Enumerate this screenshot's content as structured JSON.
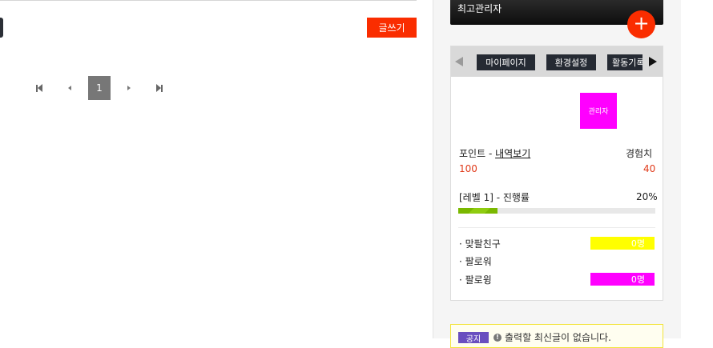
{
  "board": {
    "write_label": "글쓰기",
    "pagination": {
      "current_page": "1"
    }
  },
  "sidebar": {
    "admin_title": "최고관리자",
    "plus_label": "+",
    "menu": [
      "마이페이지",
      "환경설정",
      "활동기록"
    ],
    "avatar_text": "관리자",
    "points_label": "포인트",
    "points_sep": " - ",
    "points_history_link": "내역보기",
    "exp_label": "경험치",
    "points_value": "100",
    "exp_value": "40",
    "level_text": "[레벨 1] - 진행률",
    "progress_text": "20%",
    "progress_fraction": 0.2,
    "stats": [
      {
        "label": "· 맞팔친구",
        "value": "0명",
        "color": "#ffff00"
      },
      {
        "label": "· 팔로워",
        "value": "",
        "color": ""
      },
      {
        "label": "· 팔로윙",
        "value": "0명",
        "color": "#ff00ff"
      }
    ],
    "notice": {
      "badge": "공지",
      "text": "출력할 최신글이 없습니다."
    }
  },
  "colors": {
    "accent_red": "#fa2d00",
    "value_red": "#e03a1a",
    "progress_green": "#7ab800",
    "magenta": "#ff00ff",
    "yellow": "#ffff00",
    "dark_button": "#252a33"
  },
  "icons": [
    "first-page-icon",
    "prev-page-icon",
    "next-page-icon",
    "last-page-icon",
    "plus-icon",
    "arrow-left-icon",
    "arrow-right-icon",
    "info-icon"
  ]
}
